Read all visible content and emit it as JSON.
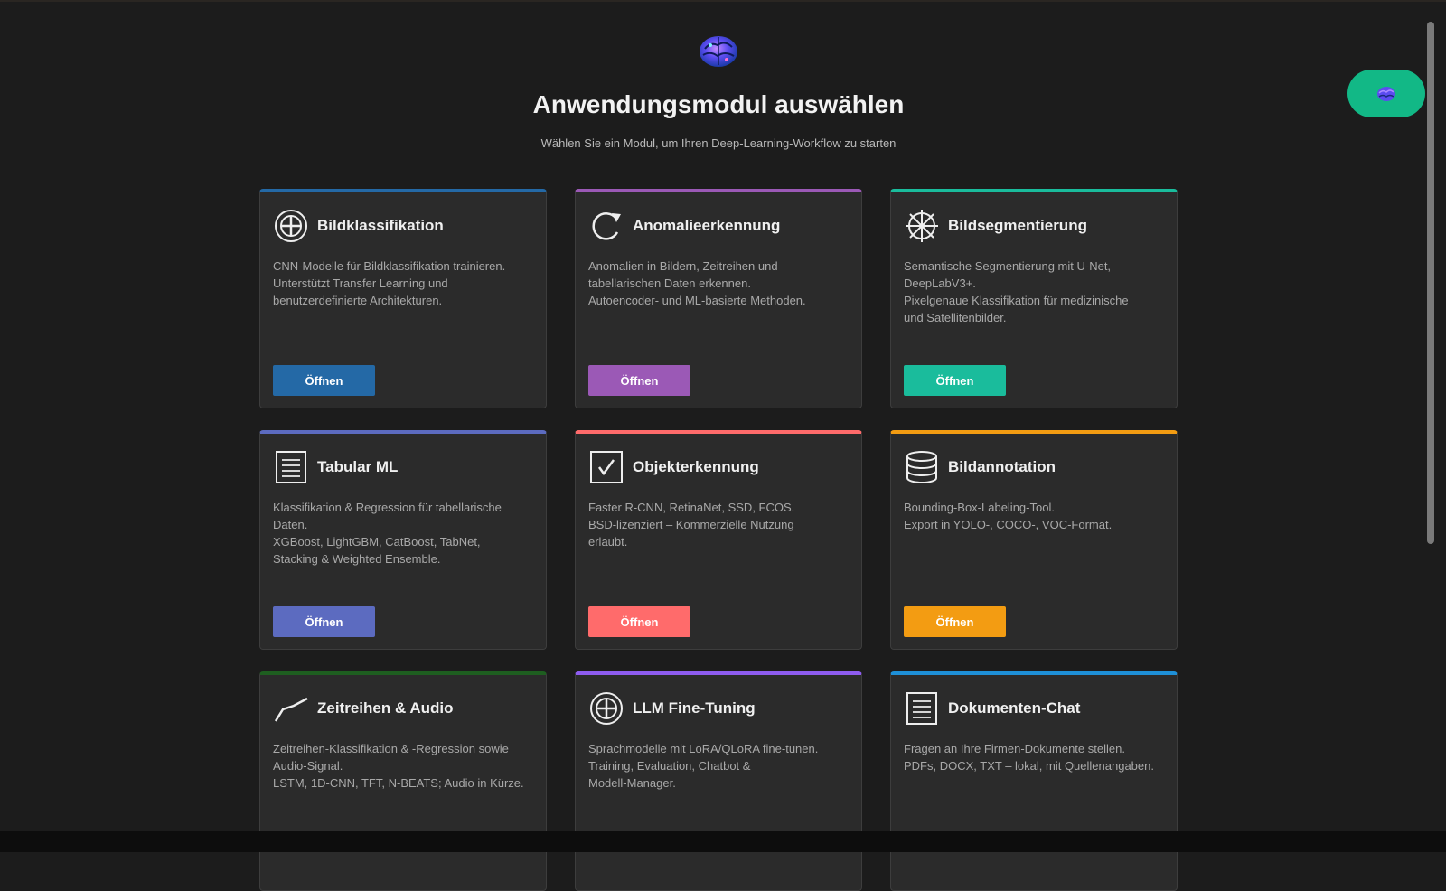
{
  "header": {
    "title": "Anwendungsmodul auswählen",
    "subtitle": "Wählen Sie ein Modul, um Ihren Deep-Learning-Workflow zu starten"
  },
  "cards": [
    {
      "icon": "crosshair-circle-icon",
      "accent": "#2469a6",
      "title": "Bildklassifikation",
      "description": "CNN-Modelle für Bildklassifikation trainieren.\nUnterstützt Transfer Learning und\nbenutzerdefinierte Architekturen.",
      "button": "Öffnen"
    },
    {
      "icon": "refresh-icon",
      "accent": "#9b59b6",
      "title": "Anomalieerkennung",
      "description": "Anomalien in Bildern, Zeitreihen und\ntabellarischen Daten erkennen.\nAutoencoder- und ML-basierte Methoden.",
      "button": "Öffnen"
    },
    {
      "icon": "wheel-icon",
      "accent": "#1abc9c",
      "title": "Bildsegmentierung",
      "description": "Semantische Segmentierung mit U-Net,\nDeepLabV3+.\nPixelgenaue Klassifikation für medizinische\nund Satellitenbilder.",
      "button": "Öffnen"
    },
    {
      "icon": "document-lines-icon",
      "accent": "#5c6bc0",
      "title": "Tabular ML",
      "description": "Klassifikation & Regression für tabellarische\nDaten.\nXGBoost, LightGBM, CatBoost, TabNet,\nStacking & Weighted Ensemble.",
      "button": "Öffnen"
    },
    {
      "icon": "checkbox-icon",
      "accent": "#ff6b6b",
      "title": "Objekterkennung",
      "description": "Faster R-CNN, RetinaNet, SSD, FCOS.\nBSD-lizenziert – Kommerzielle Nutzung\nerlaubt.",
      "button": "Öffnen"
    },
    {
      "icon": "database-icon",
      "accent": "#f39c12",
      "title": "Bildannotation",
      "description": "Bounding-Box-Labeling-Tool.\nExport in YOLO-, COCO-, VOC-Format.",
      "button": "Öffnen"
    },
    {
      "icon": "line-chart-icon",
      "accent": "#1e5e20",
      "title": "Zeitreihen & Audio",
      "description": "Zeitreihen-Klassifikation & -Regression sowie\nAudio-Signal.\nLSTM, 1D-CNN, TFT, N-BEATS; Audio in Kürze.",
      "button": ""
    },
    {
      "icon": "crosshair-circle-icon",
      "accent": "#8e5cf0",
      "title": "LLM Fine-Tuning",
      "description": "Sprachmodelle mit LoRA/QLoRA fine-tunen.\nTraining, Evaluation, Chatbot &\nModell-Manager.",
      "button": ""
    },
    {
      "icon": "document-lines-icon",
      "accent": "#1e90d8",
      "title": "Dokumenten-Chat",
      "description": "Fragen an Ihre Firmen-Dokumente stellen.\nPDFs, DOCX, TXT – lokal, mit Quellenangaben.",
      "button": ""
    }
  ]
}
